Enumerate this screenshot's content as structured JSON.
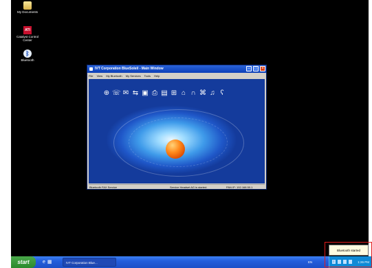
{
  "desktop": {
    "icons": [
      {
        "label": "My Documents",
        "icon": "folder-icon"
      },
      {
        "label": "Catalyst Control Center",
        "icon": "ati-logo-icon"
      },
      {
        "label": "Bluetooth",
        "icon": "bluetooth-icon"
      }
    ]
  },
  "window": {
    "title": "IVT Corporation BlueSoleil - Main Window",
    "menu": [
      "File",
      "View",
      "My Bluetooth",
      "My Services",
      "Tools",
      "Help"
    ],
    "toolbar_icons": [
      "network-icon",
      "dial-up-icon",
      "fax-icon",
      "file-transfer-icon",
      "sync-icon",
      "printer-icon",
      "serial-port-icon",
      "lan-icon",
      "hid-icon",
      "headset-icon",
      "camera-icon",
      "av-icon",
      "audio-gateway-icon"
    ],
    "status": {
      "left": "Bluetooth FAX Service",
      "center": "Service Headset AG is started.",
      "right": "PAN IP: 192.168.50.1"
    }
  },
  "taskbar": {
    "start_label": "start",
    "task_button": "IVT Corporation Blue...",
    "language": "EN",
    "clock": "1:26 PM",
    "tray_icons": [
      "bluetooth-tray-icon",
      "network-tray-icon",
      "volume-tray-icon",
      "security-tray-icon"
    ]
  },
  "notification": {
    "text": "Bluetooth started"
  },
  "colors": {
    "desktop_bg": "#000000",
    "taskbar": "#245edb",
    "start_button": "#2b8a2b",
    "highlight_box": "#e21b1b"
  }
}
